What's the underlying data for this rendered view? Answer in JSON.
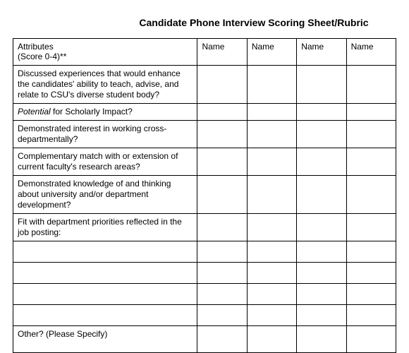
{
  "title": "Candidate Phone Interview Scoring Sheet/Rubric",
  "header": {
    "attributes_line1": "Attributes",
    "attributes_line2": "(Score 0-4)**",
    "name": "Name"
  },
  "rows": {
    "r1": "Discussed experiences that would enhance the candidates' ability to teach, advise, and relate to CSU's diverse student body?",
    "r2_prefix_italic": "Potential",
    "r2_rest": " for Scholarly Impact?",
    "r3": "Demonstrated interest in working cross-departmentally?",
    "r4": "Complementary match with or extension of current faculty's research areas?",
    "r5": "Demonstrated knowledge of and thinking about university and/or department development?",
    "r6": "Fit with department priorities reflected in the job posting:",
    "r_other": "Other? (Please Specify)"
  }
}
